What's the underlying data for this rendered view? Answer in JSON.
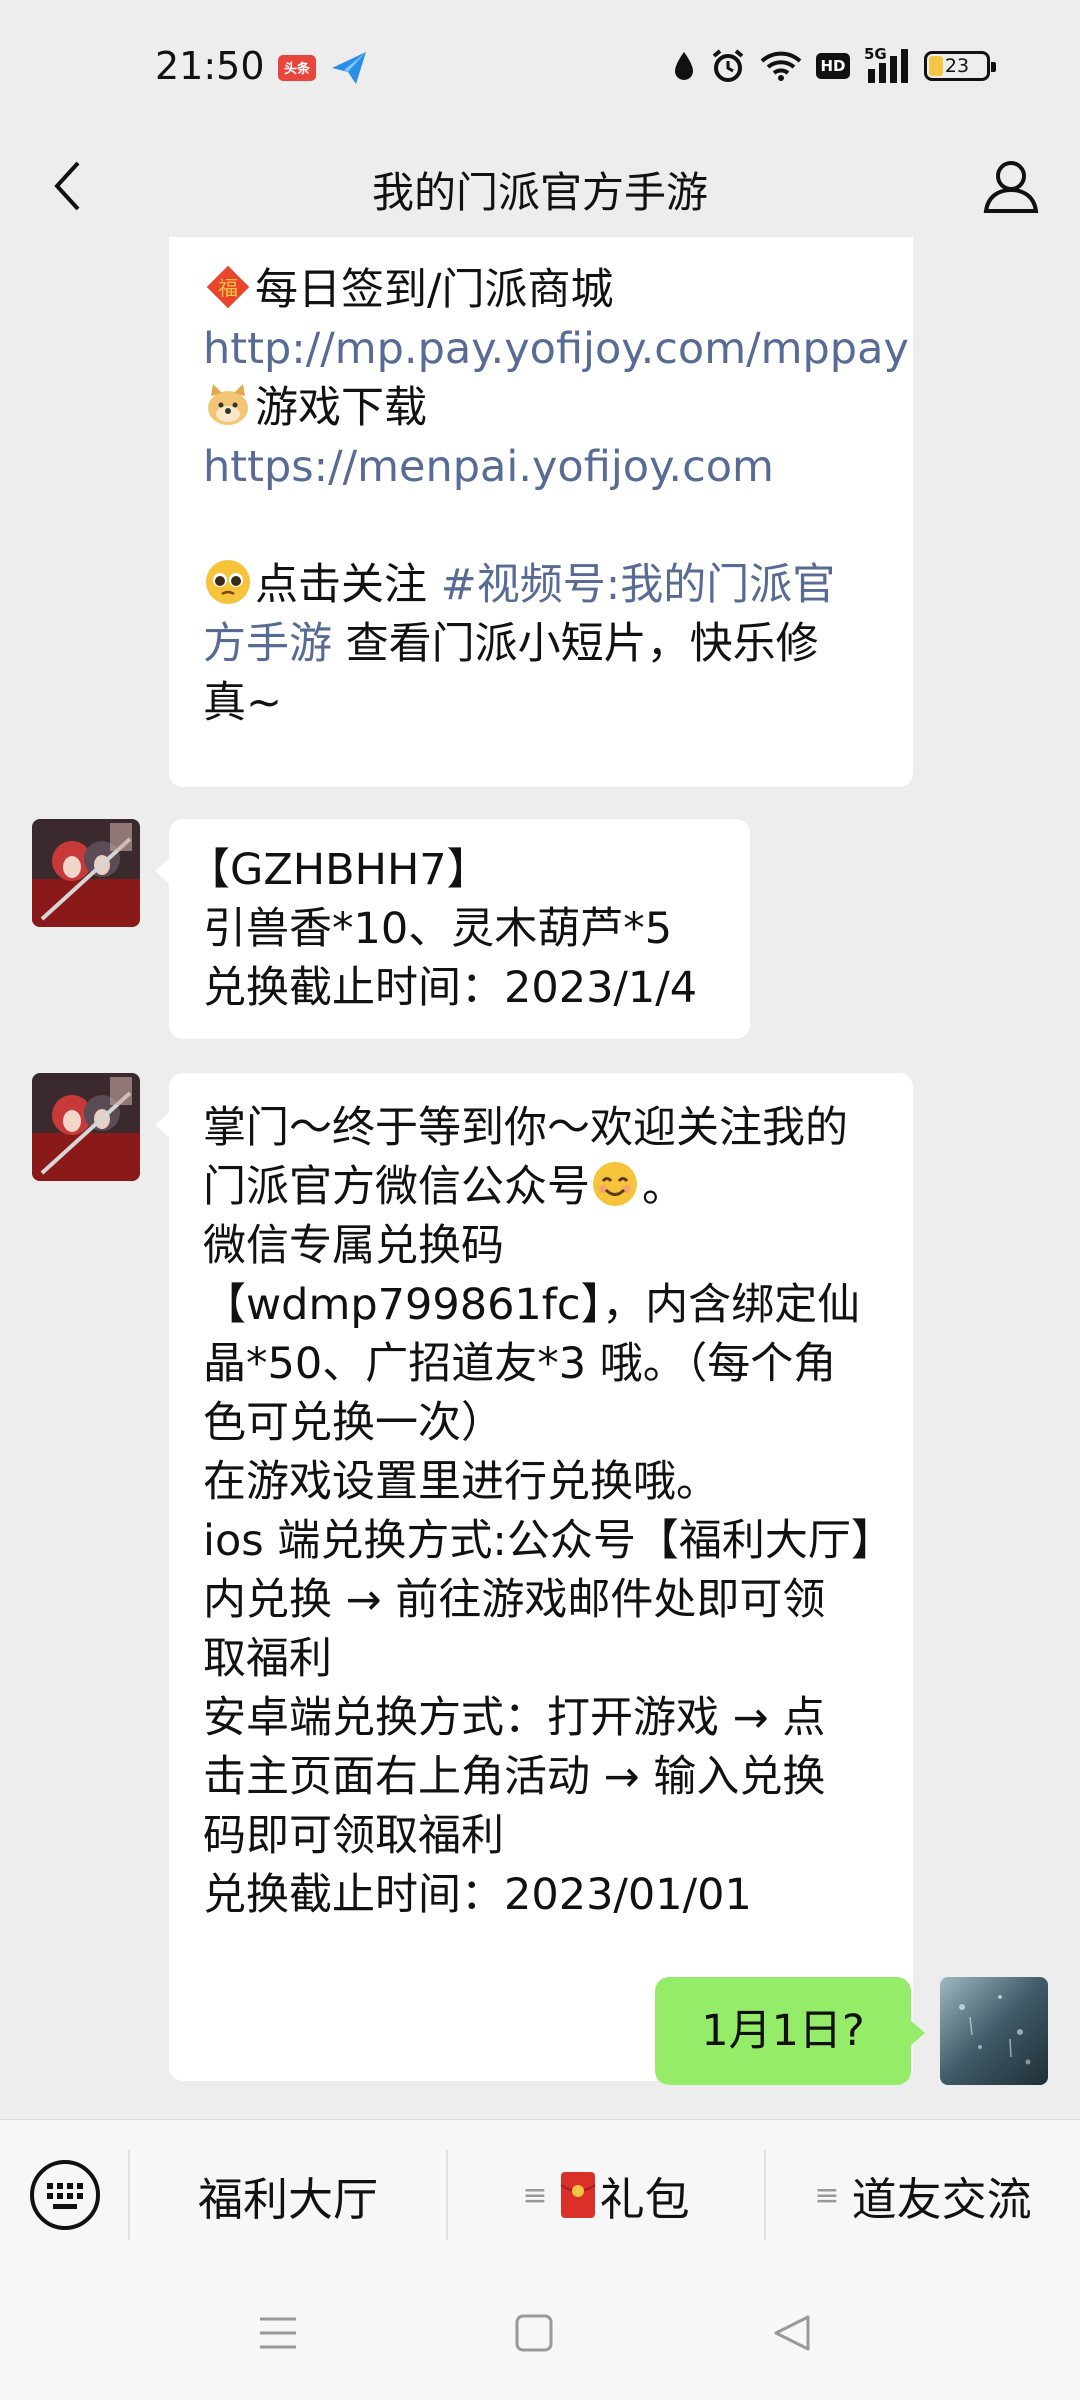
{
  "status_bar": {
    "time": "21:50",
    "toutiao_label": "头条",
    "battery_level": "23",
    "network_label": "HD",
    "signal_label": "5G"
  },
  "header": {
    "title": "我的门派官方手游",
    "back_icon": "chevron-left-icon",
    "profile_icon": "person-icon"
  },
  "messages": {
    "m1": {
      "line1_text": "每日签到/门派商城",
      "link1": "http://mp.pay.yofijoy.com/mppay",
      "line2_text": "游戏下载",
      "link2": "https://menpai.yofijoy.com",
      "line3_pre": "点击关注 ",
      "line3_link_a": "#视频号:我的门派官",
      "line3_link_b": "方手游",
      "line3_post": "  查看门派小短片，快乐修",
      "line3_end": "真~"
    },
    "m2": {
      "lines": [
        "【GZHBHH7】",
        "引兽香*10、灵木葫芦*5",
        "兑换截止时间：2023/1/4"
      ]
    },
    "m3": {
      "line1": "掌门～终于等到你～欢迎关注我的",
      "line2_pre": "门派官方微信公众号",
      "line2_post": "。",
      "lines": [
        "微信专属兑换码",
        "【wdmp799861fc】，内含绑定仙",
        "晶*50、广招道友*3 哦。（每个角",
        "色可兑换一次）",
        "在游戏设置里进行兑换哦。",
        "ios 端兑换方式:公众号【福利大厅】",
        "内兑换 → 前往游戏邮件处即可领",
        "取福利",
        "安卓端兑换方式：打开游戏 → 点",
        "击主页面右上角活动 → 输入兑换",
        "码即可领取福利",
        "兑换截止时间：2023/01/01"
      ]
    },
    "m4_self": "1月1日?"
  },
  "bottom_menu": {
    "item1": "福利大厅",
    "item2": "礼包",
    "item3": "道友交流"
  },
  "colors": {
    "background": "#ededed",
    "bubble_other": "#ffffff",
    "bubble_self": "#95ec69",
    "link": "#576b95"
  }
}
